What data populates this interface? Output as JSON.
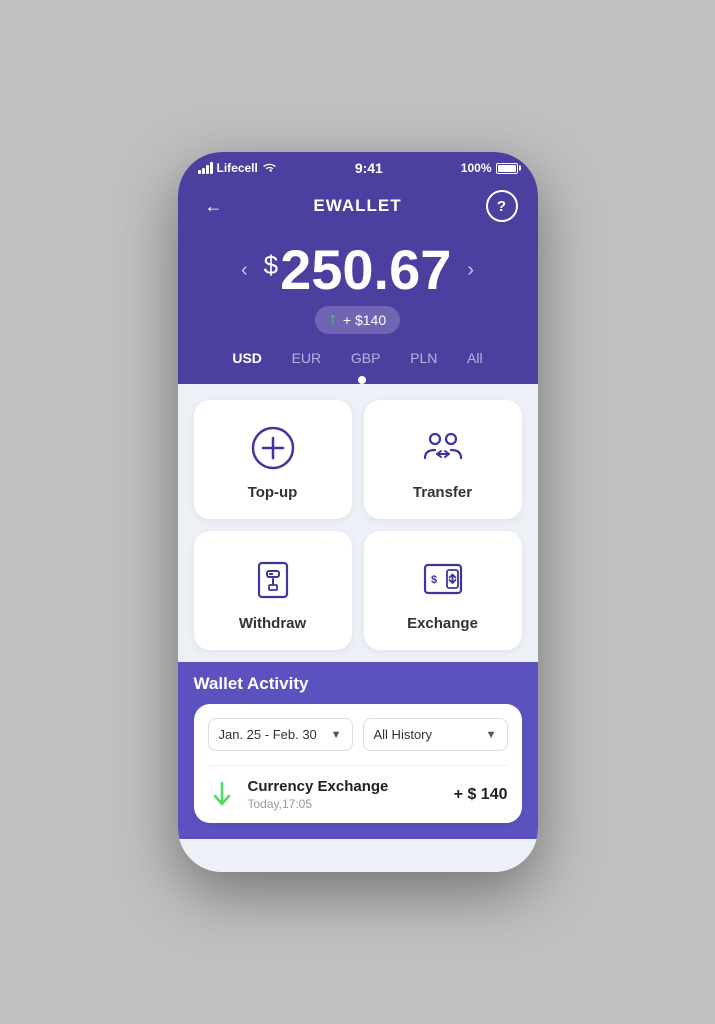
{
  "statusBar": {
    "carrier": "Lifecell",
    "time": "9:41",
    "battery": "100%"
  },
  "header": {
    "title": "EWALLET",
    "backLabel": "←",
    "helpLabel": "?"
  },
  "balance": {
    "currencySymbol": "$",
    "amount": "250.67",
    "badge": "+ $140",
    "navLeft": "‹",
    "navRight": "›"
  },
  "currencyTabs": [
    {
      "label": "USD",
      "active": true
    },
    {
      "label": "EUR",
      "active": false
    },
    {
      "label": "GBP",
      "active": false
    },
    {
      "label": "PLN",
      "active": false
    },
    {
      "label": "All",
      "active": false
    }
  ],
  "actions": [
    {
      "id": "topup",
      "label": "Top-up",
      "icon": "plus-circle"
    },
    {
      "id": "transfer",
      "label": "Transfer",
      "icon": "transfer-people"
    },
    {
      "id": "withdraw",
      "label": "Withdraw",
      "icon": "withdraw-atm"
    },
    {
      "id": "exchange",
      "label": "Exchange",
      "icon": "exchange-currency"
    }
  ],
  "walletActivity": {
    "title": "Wallet Activity",
    "dateFilter": "Jan. 25 - Feb. 30",
    "historyFilter": "All History",
    "transactions": [
      {
        "name": "Currency Exchange",
        "time": "Today,17:05",
        "amount": "+ $ 140",
        "type": "incoming",
        "icon": "arrow-down"
      }
    ]
  }
}
